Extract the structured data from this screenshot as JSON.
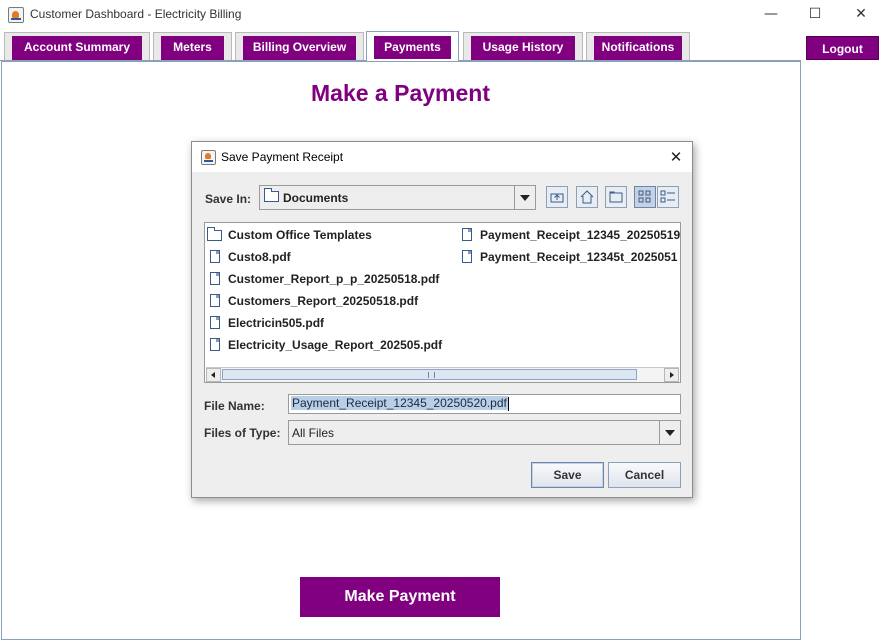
{
  "window": {
    "title": "Customer Dashboard - Electricity Billing",
    "controls": [
      "minimize",
      "maximize",
      "close"
    ]
  },
  "tabs": [
    {
      "label": "Account Summary",
      "active": false
    },
    {
      "label": "Meters",
      "active": false
    },
    {
      "label": "Billing Overview",
      "active": false
    },
    {
      "label": "Payments",
      "active": true
    },
    {
      "label": "Usage History",
      "active": false
    },
    {
      "label": "Notifications",
      "active": false
    }
  ],
  "logout_label": "Logout",
  "page": {
    "title": "Make a Payment",
    "make_payment_label": "Make Payment"
  },
  "dialog": {
    "title": "Save Payment Receipt",
    "save_in_label": "Save In:",
    "save_in_value": "Documents",
    "toolbar_icons": [
      "up-one-level-icon",
      "home-icon",
      "new-folder-icon",
      "list-view-icon",
      "details-view-icon"
    ],
    "files_col1": [
      {
        "name": "Custom Office Templates",
        "type": "folder"
      },
      {
        "name": "Custo8.pdf",
        "type": "file"
      },
      {
        "name": "Customer_Report_p_p_20250518.pdf",
        "type": "file"
      },
      {
        "name": "Customers_Report_20250518.pdf",
        "type": "file"
      },
      {
        "name": "Electricin505.pdf",
        "type": "file"
      },
      {
        "name": "Electricity_Usage_Report_202505.pdf",
        "type": "file"
      }
    ],
    "files_col2": [
      {
        "name": "Payment_Receipt_12345_20250519",
        "type": "file"
      },
      {
        "name": "Payment_Receipt_12345t_2025051",
        "type": "file"
      }
    ],
    "file_name_label": "File Name:",
    "file_name_value": "Payment_Receipt_12345_20250520.pdf",
    "files_of_type_label": "Files of Type:",
    "files_of_type_value": "All Files",
    "save_label": "Save",
    "cancel_label": "Cancel"
  },
  "colors": {
    "brand_purple": "#800080",
    "tab_border": "#8aa0bd"
  }
}
